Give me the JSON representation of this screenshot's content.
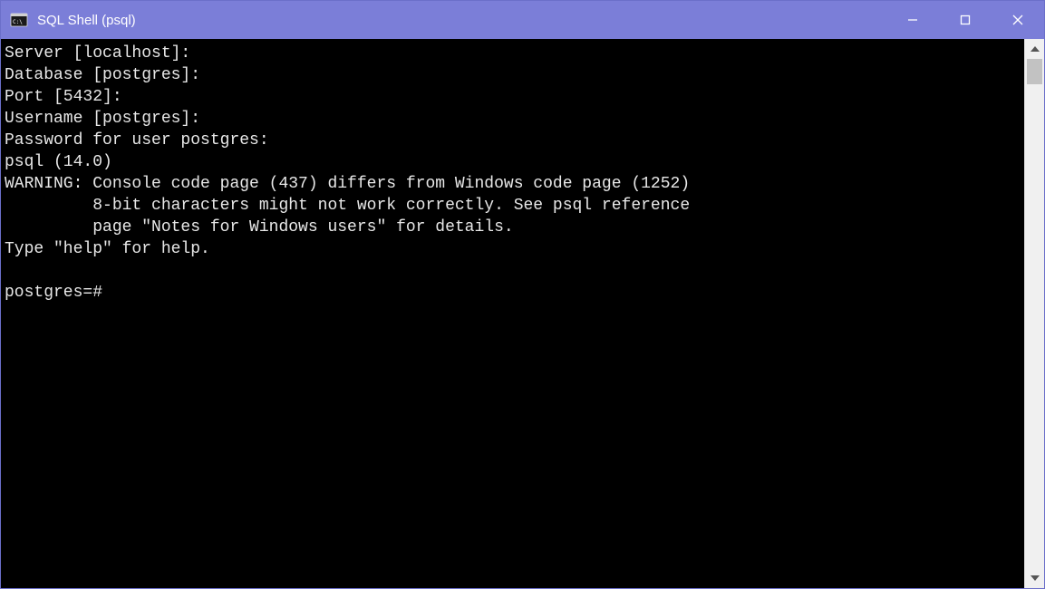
{
  "window": {
    "title": "SQL Shell (psql)"
  },
  "terminal": {
    "lines": [
      "Server [localhost]:",
      "Database [postgres]:",
      "Port [5432]:",
      "Username [postgres]:",
      "Password for user postgres:",
      "psql (14.0)",
      "WARNING: Console code page (437) differs from Windows code page (1252)",
      "         8-bit characters might not work correctly. See psql reference",
      "         page \"Notes for Windows users\" for details.",
      "Type \"help\" for help.",
      "",
      "postgres=#"
    ]
  }
}
